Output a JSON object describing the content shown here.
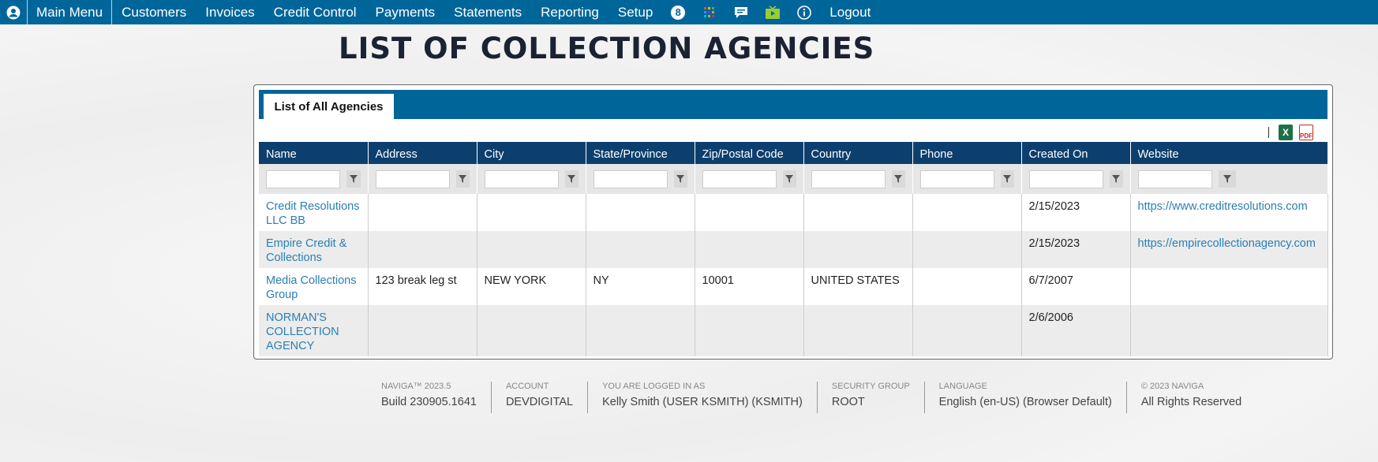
{
  "nav": {
    "items": [
      "Main Menu",
      "Customers",
      "Invoices",
      "Credit Control",
      "Payments",
      "Statements",
      "Reporting",
      "Setup"
    ],
    "badge": "8",
    "logout": "Logout"
  },
  "page_title": "LIST OF COLLECTION AGENCIES",
  "tab_label": "List of All Agencies",
  "exports": {
    "excel_label": "X",
    "pdf_label": "PDF"
  },
  "columns": [
    "Name",
    "Address",
    "City",
    "State/Province",
    "Zip/Postal Code",
    "Country",
    "Phone",
    "Created On",
    "Website"
  ],
  "rows": [
    {
      "name": "Credit Resolutions LLC BB",
      "address": "",
      "city": "",
      "state": "",
      "zip": "",
      "country": "",
      "phone": "",
      "created": "2/15/2023",
      "website": "https://www.creditresolutions.com"
    },
    {
      "name": "Empire Credit & Collections",
      "address": "",
      "city": "",
      "state": "",
      "zip": "",
      "country": "",
      "phone": "",
      "created": "2/15/2023",
      "website": "https://empirecollectionagency.com"
    },
    {
      "name": "Media Collections Group",
      "address": "123 break leg st",
      "city": "NEW YORK",
      "state": "NY",
      "zip": "10001",
      "country": "UNITED STATES",
      "phone": "",
      "created": "6/7/2007",
      "website": ""
    },
    {
      "name": "NORMAN'S COLLECTION AGENCY",
      "address": "",
      "city": "",
      "state": "",
      "zip": "",
      "country": "",
      "phone": "",
      "created": "2/6/2006",
      "website": ""
    }
  ],
  "footer": [
    {
      "label": "NAVIGA™ 2023.5",
      "value": "Build 230905.1641"
    },
    {
      "label": "ACCOUNT",
      "value": "DEVDIGITAL"
    },
    {
      "label": "YOU ARE LOGGED IN AS",
      "value": "Kelly Smith (USER KSMITH) (KSMITH)"
    },
    {
      "label": "SECURITY GROUP",
      "value": "ROOT"
    },
    {
      "label": "LANGUAGE",
      "value": "English (en-US) (Browser Default)"
    },
    {
      "label": "© 2023 NAVIGA",
      "value": "All Rights Reserved"
    }
  ],
  "colors": {
    "nav": "#00669a",
    "header": "#0d3f6e",
    "link": "#2a7fb3"
  }
}
